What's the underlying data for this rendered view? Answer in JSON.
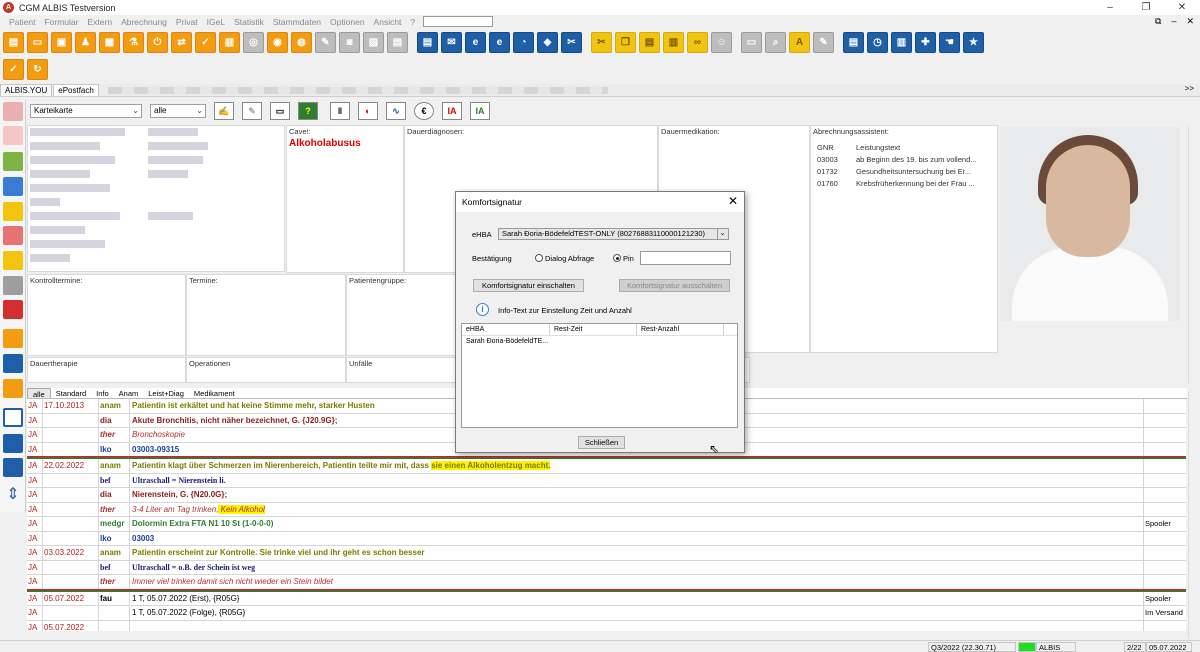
{
  "window": {
    "title": "CGM ALBIS Testversion",
    "app_icon_label": "A",
    "controls": [
      "–",
      "❐",
      "✕"
    ]
  },
  "menu": {
    "items": [
      "Patient",
      "Formular",
      "Extern",
      "Abrechnung",
      "Privat",
      "IGeL",
      "Statistik",
      "Stammdaten",
      "Optionen",
      "Ansicht",
      "?"
    ],
    "right_icons": [
      "⧉",
      "–",
      "✕"
    ]
  },
  "tabs": {
    "items": [
      "ALBIS.YOU",
      "ePostfach"
    ],
    "overflow_label": ">>"
  },
  "karteikarte": {
    "view_select": "Karteikarte",
    "filter_select": "alle"
  },
  "sections": {
    "cave_label": "Cave!:",
    "cave_value": "Alkoholabusus",
    "dauerdiagnosen_label": "Dauerdiagnosen:",
    "dauermedikation_label": "Dauermedikation:",
    "abrechnungsassistent_label": "Abrechnungsassistent:",
    "kontrolltermine_label": "Kontrolltermine:",
    "termine_label": "Termine:",
    "patientengruppe_label": "Patientengruppe:",
    "dauertherapie_label": "Dauertherapie",
    "operationen_label": "Operationen",
    "unfaelle_label": "Unfälle"
  },
  "abrechnung": {
    "headers": [
      "GNR",
      "Leistungstext"
    ],
    "rows": [
      {
        "gnr": "03003",
        "text": "ab Beginn des 19. bis zum vollend..."
      },
      {
        "gnr": "01732",
        "text": "Gesundheitsuntersuchung bei Er..."
      },
      {
        "gnr": "01760",
        "text": "Krebsfrüherkennung bei der Frau ..."
      }
    ]
  },
  "filter_tabs": [
    "alle",
    "Standard",
    "Info",
    "Anam",
    "Leist+Diag",
    "Medikament"
  ],
  "journal": [
    {
      "ja": "JA",
      "date": "17.10.2013",
      "cat": "anam",
      "catClass": "olive",
      "text": "Patientin ist erkältet und hat keine Stimme mehr, starker Husten",
      "textClass": "olive",
      "extra": ""
    },
    {
      "ja": "JA",
      "date": "",
      "cat": "dia",
      "catClass": "darkred",
      "text": "Akute Bronchitis, nicht näher bezeichnet, G. {J20.9G};",
      "textClass": "darkred",
      "extra": ""
    },
    {
      "ja": "JA",
      "date": "",
      "cat": "ther",
      "catClass": "redit",
      "text": "Bronchoskopie",
      "textClass": "redit",
      "extra": ""
    },
    {
      "ja": "JA",
      "date": "",
      "cat": "lko",
      "catClass": "blue-b",
      "text": "03003-09315",
      "textClass": "blue-b",
      "extra": ""
    },
    {
      "ja": "JA",
      "date": "22.02.2022",
      "cat": "anam",
      "catClass": "olive",
      "text": "Patientin klagt über Schmerzen im Nierenbereich, Patientin teilte mir mit, dass ",
      "highlight": "sie einen Alkoholentzug macht.",
      "textClass": "olive",
      "extra": ""
    },
    {
      "ja": "JA",
      "date": "",
      "cat": "bef",
      "catClass": "navy-serif",
      "text": "Ultraschall = Nierenstein li.",
      "textClass": "navy-serif",
      "extra": ""
    },
    {
      "ja": "JA",
      "date": "",
      "cat": "dia",
      "catClass": "darkred",
      "text": "Nierenstein, G. {N20.0G};",
      "textClass": "darkred",
      "extra": ""
    },
    {
      "ja": "JA",
      "date": "",
      "cat": "ther",
      "catClass": "redit",
      "text": "3-4 Liter am Tag trinken,",
      "highlight": " Kein Alkohol",
      "textClass": "redit",
      "extra": ""
    },
    {
      "ja": "JA",
      "date": "",
      "cat": "medgr",
      "catClass": "green-b",
      "text": "Dolormin Extra FTA N1 10 St (1-0-0-0)",
      "textClass": "green-b",
      "extra": "Spooler"
    },
    {
      "ja": "JA",
      "date": "",
      "cat": "lko",
      "catClass": "blue-b",
      "text": "03003",
      "textClass": "blue-b",
      "extra": ""
    },
    {
      "ja": "JA",
      "date": "03.03.2022",
      "cat": "anam",
      "catClass": "olive",
      "text": "Patientin erscheint zur Kontrolle. Sie trinke viel und ihr geht es schon besser",
      "textClass": "olive",
      "extra": ""
    },
    {
      "ja": "JA",
      "date": "",
      "cat": "bef",
      "catClass": "navy-serif",
      "text": "Ultraschall = o.B. der Schein ist weg",
      "textClass": "navy-serif",
      "extra": ""
    },
    {
      "ja": "JA",
      "date": "",
      "cat": "ther",
      "catClass": "redit",
      "text": "Immer viel trinken damit sich nicht wieder ein Stein bildet",
      "textClass": "redit",
      "extra": ""
    },
    {
      "ja": "JA",
      "date": "05.07.2022",
      "cat": "fau",
      "catClass": "plain",
      "text": "1 T, 05.07.2022 (Erst), {R05G}",
      "textClass": "plain",
      "extra": "Spooler"
    },
    {
      "ja": "JA",
      "date": "",
      "cat": "",
      "catClass": "plain",
      "text": "1 T, 05.07.2022 (Folge), {R05G}",
      "textClass": "plain",
      "extra": "Im Versand"
    },
    {
      "ja": "JA",
      "date": "05.07.2022",
      "cat": "",
      "catClass": "plain",
      "text": "",
      "textClass": "plain",
      "extra": ""
    }
  ],
  "dialog": {
    "title": "Komfortsignatur",
    "ehba_label": "eHBA",
    "ehba_value": "Sarah Ðoria-BödefeldTEST-ONLY (80276883110000121230)",
    "bestaetigung_label": "Bestätigung",
    "radio_dialog": "Dialog Abfrage",
    "radio_pin": "Pin",
    "btn_on": "Komfortsignatur einschalten",
    "btn_off": "Komfortsignatur ausschalten",
    "info_text": "Info-Text zur Einstellung Zeit und Anzahl",
    "list_headers": [
      "eHBA",
      "Rest-Zeit",
      "Rest-Anzahl"
    ],
    "list_rows": [
      "Sarah Ðoria-BödefeldTE..."
    ],
    "close_button": "Schließen"
  },
  "status": {
    "quarter": "Q3/2022 (22.30.71)",
    "app": "ALBIS",
    "pages": "2/22",
    "date": "05.07.2022",
    "status_color": "#22dd22"
  }
}
